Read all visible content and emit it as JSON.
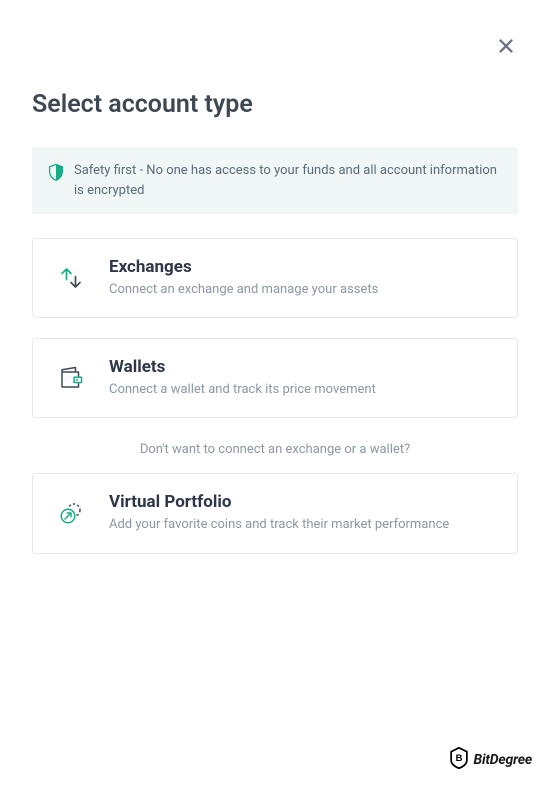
{
  "title": "Select account type",
  "safety_message": "Safety first - No one has access to your funds and all account information is encrypted",
  "options": {
    "exchanges": {
      "title": "Exchanges",
      "desc": "Connect an exchange and manage your assets"
    },
    "wallets": {
      "title": "Wallets",
      "desc": "Connect a wallet and track its price movement"
    },
    "virtual": {
      "title": "Virtual Portfolio",
      "desc": "Add your favorite coins and track their market performance"
    }
  },
  "separator": "Don't want to connect an exchange or a wallet?",
  "watermark": "BitDegree"
}
